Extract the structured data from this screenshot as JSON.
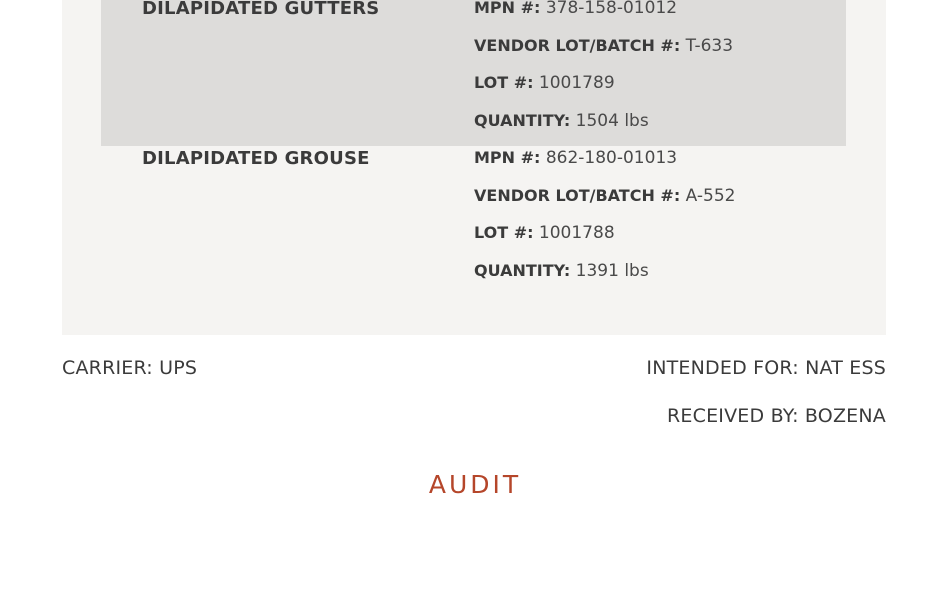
{
  "items": [
    {
      "name": "DILAPIDATED GUTTERS",
      "mpn_label": "MPN #:",
      "mpn": "378-158-01012",
      "vendor_lot_label": "VENDOR LOT/BATCH #:",
      "vendor_lot": "T-633",
      "lot_label": "LOT #:",
      "lot": "1001789",
      "quantity_label": "QUANTITY:",
      "quantity": "1504 lbs"
    },
    {
      "name": "DILAPIDATED GROUSE",
      "mpn_label": "MPN #:",
      "mpn": "862-180-01013",
      "vendor_lot_label": "VENDOR LOT/BATCH #:",
      "vendor_lot": "A-552",
      "lot_label": "LOT #:",
      "lot": "1001788",
      "quantity_label": "QUANTITY:",
      "quantity": "1391 lbs"
    }
  ],
  "footer": {
    "carrier": "CARRIER: UPS",
    "intended_for": "INTENDED FOR: NAT ESS",
    "received_by": "RECEIVED BY: BOZENA"
  },
  "audit_label": "AUDIT",
  "colors": {
    "accent": "#b5462a",
    "panel_bg": "#f5f4f2",
    "highlight_bg": "#dddcda"
  }
}
